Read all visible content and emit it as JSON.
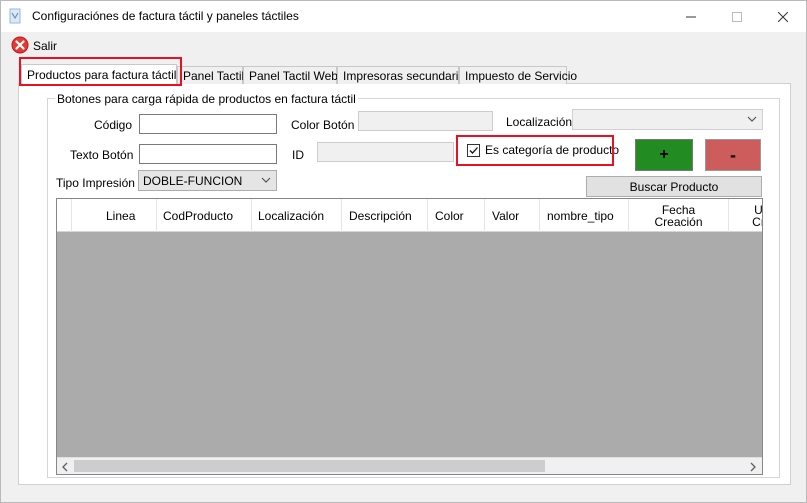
{
  "window": {
    "title": "Configuraciónes de factura táctil y paneles táctiles"
  },
  "menu": {
    "salir_label": "Salir"
  },
  "tabs": [
    {
      "label": "Productos para factura táctil"
    },
    {
      "label": "Panel Tactil"
    },
    {
      "label": "Panel Tactil Web"
    },
    {
      "label": "Impresoras secundarias"
    },
    {
      "label": "Impuesto de Servicio"
    }
  ],
  "group": {
    "title": "Botones para carga rápida de productos  en factura táctil"
  },
  "form": {
    "codigo_label": "Código",
    "codigo_value": "",
    "texto_boton_label": "Texto Botón",
    "texto_boton_value": "",
    "color_boton_label": "Color Botón",
    "id_label": "ID",
    "localizacion_label": "Localización",
    "localizacion_value": "",
    "es_categoria_label": "Es categoría de producto",
    "es_categoria_checked": true,
    "tipo_impresion_label": "Tipo Impresión",
    "tipo_impresion_value": "DOBLE-FUNCION",
    "add_label": "+",
    "remove_label": "-",
    "buscar_label": "Buscar Producto"
  },
  "grid": {
    "columns": [
      {
        "line1": "Linea",
        "line2": ""
      },
      {
        "line1": "CodProducto",
        "line2": ""
      },
      {
        "line1": "Localización",
        "line2": ""
      },
      {
        "line1": "Descripción",
        "line2": ""
      },
      {
        "line1": "Color",
        "line2": ""
      },
      {
        "line1": "Valor",
        "line2": ""
      },
      {
        "line1": "nombre_tipo",
        "line2": ""
      },
      {
        "line1": "Fecha",
        "line2": "Creación"
      },
      {
        "line1": "U",
        "line2": "Cr"
      }
    ],
    "rows": []
  },
  "colors": {
    "highlight": "#e81123",
    "add_button": "#228b22",
    "remove_button": "#cd5c5c",
    "grid_background": "#ababab"
  }
}
